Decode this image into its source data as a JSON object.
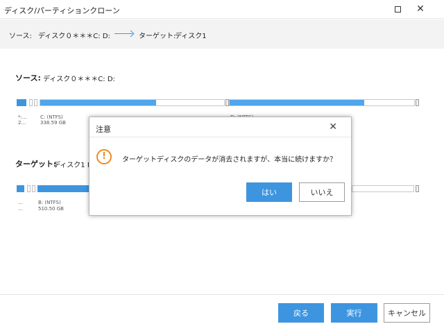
{
  "window": {
    "title": "ディスク/パーティションクローン",
    "maximize_icon": "maximize-icon",
    "close_icon": "close-icon"
  },
  "infobar": {
    "source_label": "ソース:",
    "source_value": "ディスク０＊＊＊C: D:",
    "target_label": "ターゲット:",
    "target_value": "ディスク1"
  },
  "source": {
    "label": "ソース:",
    "value": "ディスク０＊＊＊C: D:",
    "partitions": [
      {
        "top": "*:…",
        "bottom": "2…"
      },
      {
        "top": "C: (NTFS)",
        "bottom": "338.59 GB"
      },
      {
        "top": "D: (NTFS)",
        "bottom": ""
      }
    ]
  },
  "target": {
    "label": "ターゲット:",
    "value": "ディスク1 F",
    "partitions": [
      {
        "top": "…",
        "bottom": "…"
      },
      {
        "top": "B: (NTFS)",
        "bottom": "510.50 GB"
      }
    ]
  },
  "dialog": {
    "title": "注意",
    "message": "ターゲットディスクのデータが消去されますが、本当に続けますか？",
    "warning_glyph": "!",
    "yes_label": "はい",
    "no_label": "いいえ"
  },
  "footer": {
    "back_label": "戻る",
    "execute_label": "実行",
    "cancel_label": "キャンセル"
  },
  "colors": {
    "accent": "#3d95e0",
    "warning": "#ef8a1e",
    "bar_fill": "#4fa6ec"
  }
}
